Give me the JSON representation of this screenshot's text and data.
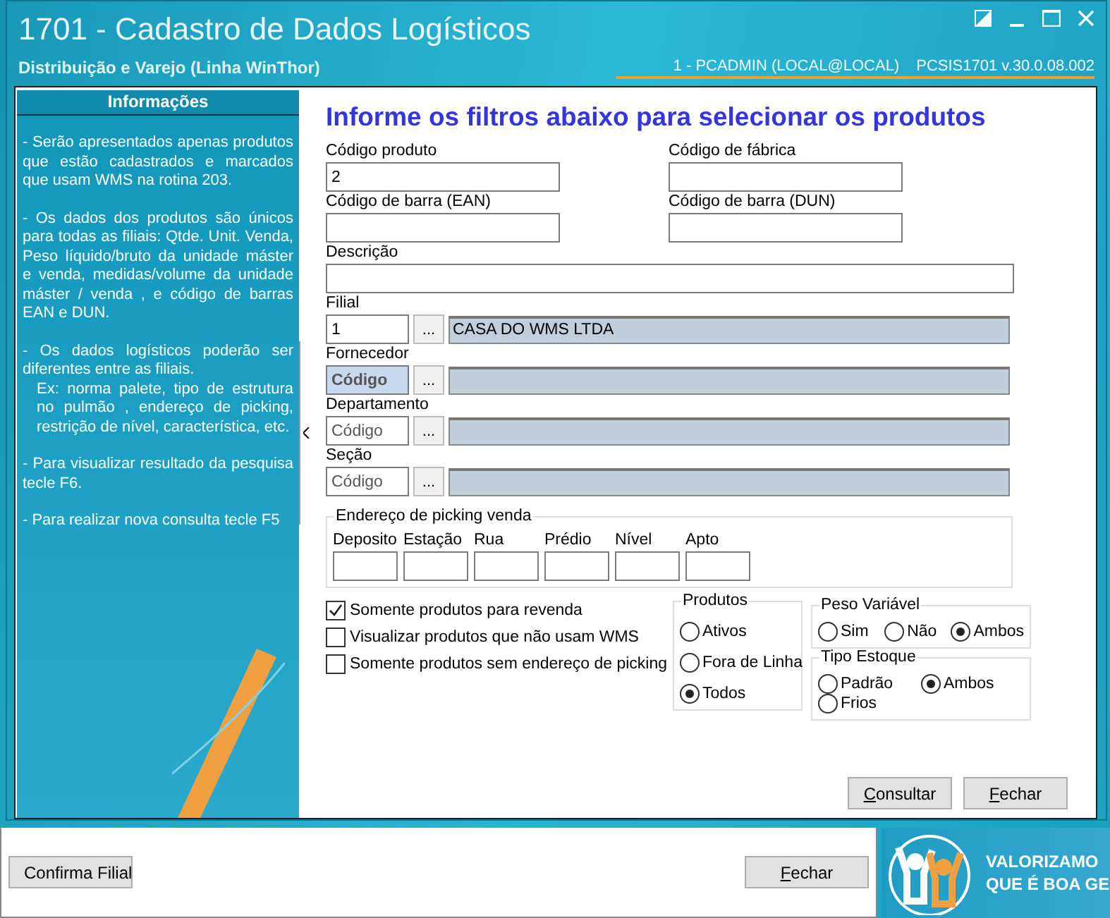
{
  "window": {
    "title": "1701 - Cadastro de Dados Logísticos",
    "subtitle": "Distribuição e Varejo (Linha WinThor)",
    "session": "1 - PCADMIN (LOCAL@LOCAL)",
    "version": "PCSIS1701  v.30.0.08.002"
  },
  "info": {
    "title": "Informações",
    "paragraphs": [
      {
        "kind": "bullet",
        "text": "- Serão apresentados apenas produtos que estão cadastrados e marcados que usam WMS na rotina 203."
      },
      {
        "kind": "bullet",
        "text": "- Os dados dos produtos são únicos para todas as filiais: Qtde. Unit. Venda, Peso líquido/bruto da unidade máster e venda, medidas/volume da unidade máster / venda , e código de barras EAN e DUN."
      },
      {
        "kind": "bullet",
        "text": "- Os dados logísticos poderão ser diferentes entre as filiais."
      },
      {
        "kind": "example",
        "text": "Ex: norma palete, tipo de estrutura no pulmão , endereço de picking, restrição de nível, característica, etc."
      },
      {
        "kind": "bullet",
        "text": "- Para visualizar resultado da pesquisa tecle F6."
      },
      {
        "kind": "bullet",
        "text": "- Para realizar nova consulta tecle F5"
      }
    ]
  },
  "form": {
    "heading": "Informe os filtros abaixo para selecionar os produtos",
    "fields": [
      {
        "label": "Código produto",
        "value": "2",
        "kind": "short"
      },
      {
        "label": "Código de fábrica",
        "kind": "short"
      },
      {
        "label": "Código de barra (EAN)",
        "kind": "short"
      },
      {
        "label": "Código de barra (DUN)",
        "kind": "short"
      },
      {
        "label": "Descrição",
        "kind": "long"
      }
    ],
    "lookups": [
      {
        "label": "Filial",
        "code": "1",
        "name": "CASA DO WMS LTDA",
        "button": "...",
        "focused": false
      },
      {
        "label": "Fornecedor",
        "code_placeholder": "Código",
        "button": "...",
        "focused": true
      },
      {
        "label": "Departamento",
        "code_placeholder": "Código",
        "button": "...",
        "focused": false
      },
      {
        "label": "Seção",
        "code_placeholder": "Código",
        "button": "...",
        "focused": false
      }
    ],
    "picking": {
      "title": "Endereço de picking venda",
      "fields": [
        "Deposito",
        "Estação",
        "Rua",
        "Prédio",
        "Nível",
        "Apto"
      ]
    },
    "checkboxes": [
      {
        "label": "Somente produtos para revenda",
        "checked": true
      },
      {
        "label": "Visualizar produtos que não usam WMS",
        "checked": false
      },
      {
        "label": "Somente produtos sem endereço de picking",
        "checked": false
      }
    ],
    "produtos": {
      "title": "Produtos",
      "options": [
        {
          "label": "Ativos",
          "selected": false
        },
        {
          "label": "Fora de Linha",
          "selected": false
        },
        {
          "label": "Todos",
          "selected": true
        }
      ]
    },
    "peso": {
      "title": "Peso Variável",
      "options": [
        {
          "label": "Sim",
          "selected": false
        },
        {
          "label": "Não",
          "selected": false
        },
        {
          "label": "Ambos",
          "selected": true
        }
      ]
    },
    "estoque": {
      "title": "Tipo Estoque",
      "options": [
        {
          "label": "Padrão",
          "selected": false
        },
        {
          "label": "Ambos",
          "selected": true
        },
        {
          "label": "Frios",
          "selected": false
        }
      ]
    },
    "buttons": [
      {
        "label": "Consultar",
        "access_key": true
      },
      {
        "label": "Fechar",
        "access_key": true
      }
    ]
  },
  "back_window": {
    "buttons": [
      {
        "label": "Confirma Filial",
        "access_key": false
      },
      {
        "label": "Fechar",
        "access_key": true
      }
    ]
  },
  "banner": {
    "lines": [
      "VALORIZAMO",
      "QUE É BOA GE"
    ]
  }
}
